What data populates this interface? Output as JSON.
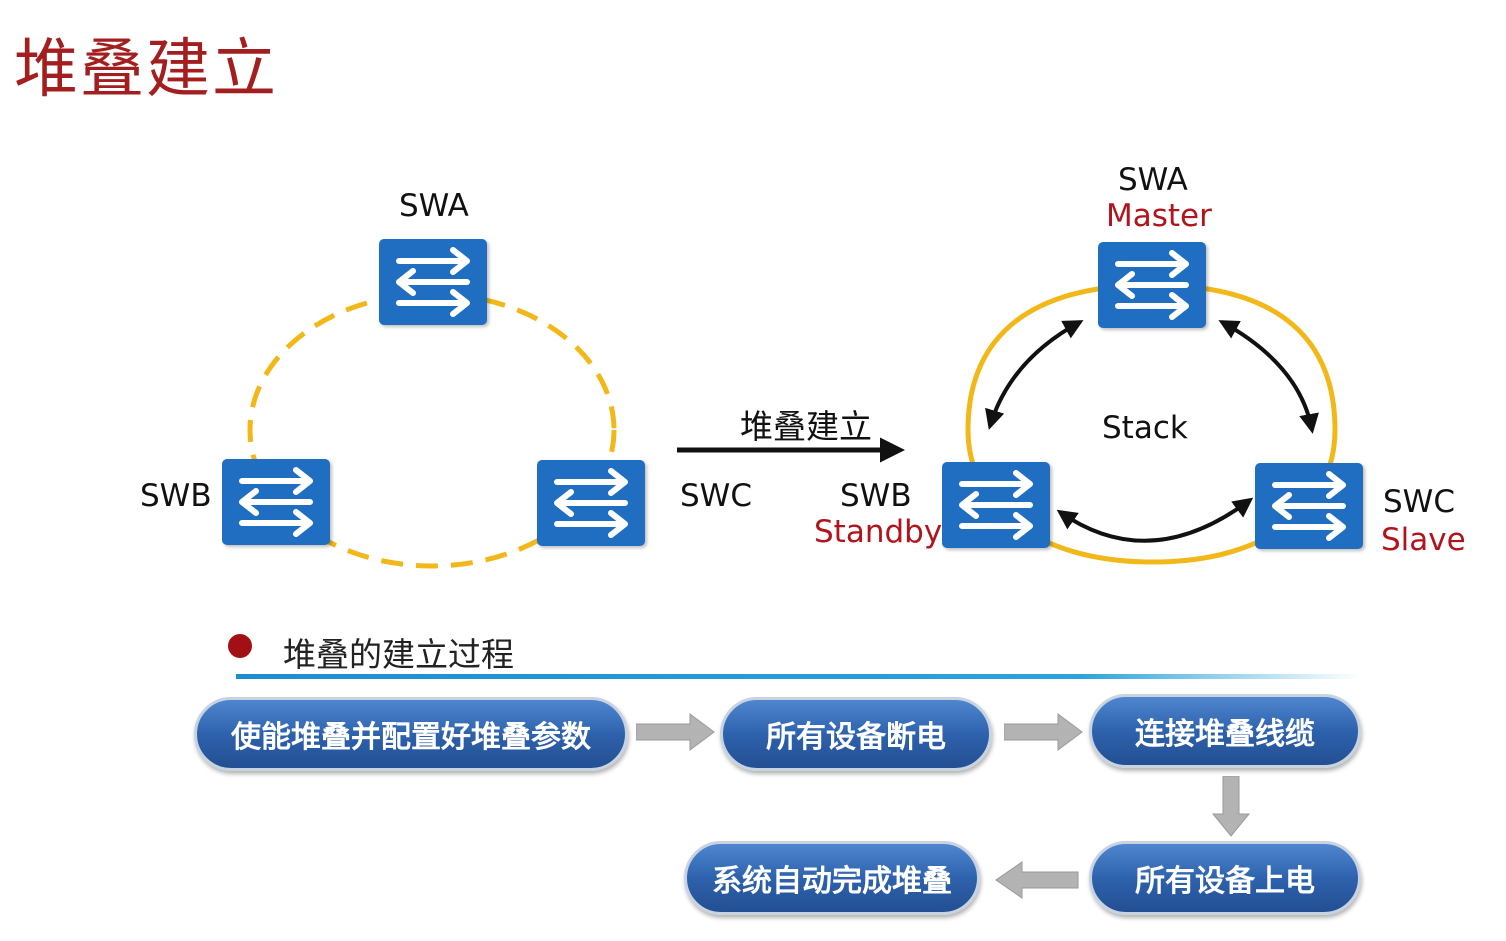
{
  "title": "堆叠建立",
  "diagram": {
    "before": {
      "nodes": [
        {
          "id": "SWA",
          "label": "SWA"
        },
        {
          "id": "SWB",
          "label": "SWB"
        },
        {
          "id": "SWC",
          "label": "SWC"
        }
      ]
    },
    "transition_label": "堆叠建立",
    "after": {
      "center_label": "Stack",
      "nodes": [
        {
          "id": "SWA",
          "label": "SWA",
          "role": "Master"
        },
        {
          "id": "SWB",
          "label": "SWB",
          "role": "Standby"
        },
        {
          "id": "SWC",
          "label": "SWC",
          "role": "Slave"
        }
      ]
    },
    "colors": {
      "switch_blue": "#1f6ec2",
      "ring_yellow": "#f2b81a",
      "role_red": "#b0141c",
      "title_red": "#a31f1f"
    }
  },
  "process": {
    "title": "堆叠的建立过程",
    "steps": [
      "使能堆叠并配置好堆叠参数",
      "所有设备断电",
      "连接堆叠线缆",
      "所有设备上电",
      "系统自动完成堆叠"
    ]
  }
}
